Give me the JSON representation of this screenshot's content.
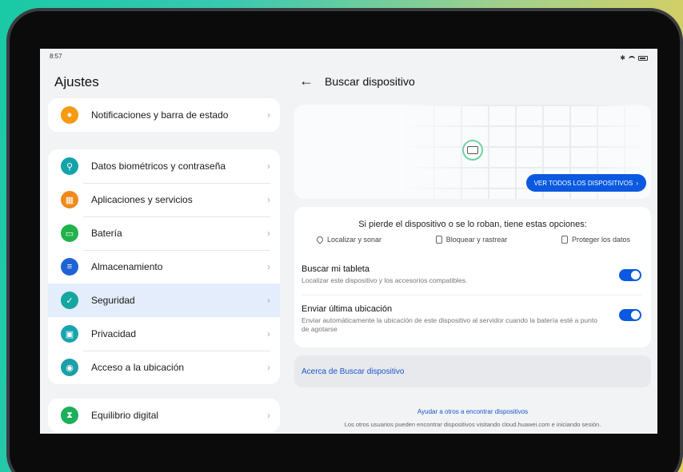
{
  "status": {
    "time": "8:57"
  },
  "left": {
    "title": "Ajustes",
    "items": [
      {
        "label": "Notificaciones y barra de estado",
        "icon": "bell-icon",
        "color": "#f59a12"
      },
      {
        "label": "Datos biométricos y contraseña",
        "icon": "key-icon",
        "color": "#14a3a8"
      },
      {
        "label": "Aplicaciones y servicios",
        "icon": "apps-icon",
        "color": "#f08a1a"
      },
      {
        "label": "Batería",
        "icon": "battery-icon",
        "color": "#21b24b"
      },
      {
        "label": "Almacenamiento",
        "icon": "storage-icon",
        "color": "#1e63d6"
      },
      {
        "label": "Seguridad",
        "icon": "shield-icon",
        "color": "#16a6a0"
      },
      {
        "label": "Privacidad",
        "icon": "lock-icon",
        "color": "#18a5b0"
      },
      {
        "label": "Acceso a la ubicación",
        "icon": "location-icon",
        "color": "#1ba0a8"
      },
      {
        "label": "Equilibrio digital",
        "icon": "hourglass-icon",
        "color": "#1bb05a"
      }
    ]
  },
  "right": {
    "title": "Buscar dispositivo",
    "all_devices_label": "VER TODOS LOS DISPOSITIVOS",
    "options_title": "Si pierde el dispositivo o se lo roban, tiene estas opciones:",
    "options": [
      "Localizar y sonar",
      "Bloquear y rastrear",
      "Proteger los datos"
    ],
    "find_tablet": {
      "title": "Buscar mi tableta",
      "subtitle": "Localizar este dispositivo y los accesorios compatibles.",
      "enabled": true
    },
    "send_location": {
      "title": "Enviar última ubicación",
      "subtitle": "Enviar automáticamente la ubicación de este dispositivo al servidor cuando la batería esté a punto de agotarse",
      "enabled": true
    },
    "about_link": "Acerca de Buscar dispositivo",
    "help_link": "Ayudar a otros a encontrar dispositivos",
    "help_text": "Los otros usuarios pueden encontrar dispositivos visitando cloud.huawei.com e iniciando sesión."
  },
  "colors": {
    "accent": "#0a59e0",
    "selected_bg": "#e3edfb"
  }
}
